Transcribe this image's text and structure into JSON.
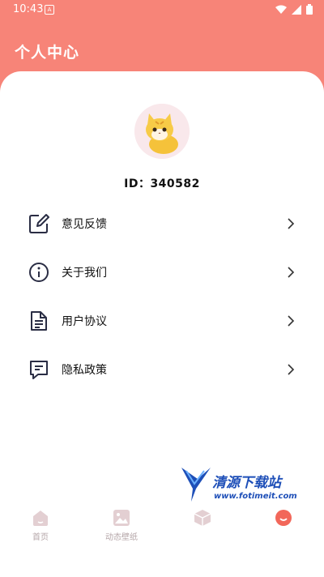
{
  "status_bar": {
    "time": "10:43",
    "notification_icon": "a-icon",
    "wifi_icon": "wifi-icon",
    "signal_icon": "signal-icon",
    "battery_icon": "battery-icon"
  },
  "header": {
    "title": "个人中心"
  },
  "profile": {
    "id_text": "ID：340582"
  },
  "menu": {
    "items": [
      {
        "label": "意见反馈",
        "icon": "edit-icon"
      },
      {
        "label": "关于我们",
        "icon": "info-icon"
      },
      {
        "label": "用户协议",
        "icon": "document-icon"
      },
      {
        "label": "隐私政策",
        "icon": "message-icon"
      }
    ]
  },
  "tabbar": {
    "tabs": [
      {
        "label": "首页",
        "icon": "home-icon"
      },
      {
        "label": "动态壁纸",
        "icon": "image-icon"
      },
      {
        "label": "",
        "icon": "box-icon"
      },
      {
        "label": "",
        "icon": "profile-icon"
      }
    ]
  },
  "watermark": {
    "title": "清源下载站",
    "url": "www.fotimeit.com"
  },
  "colors": {
    "accent": "#f78478",
    "tab_inactive": "#e3cfd2",
    "tab_active": "#f2675a"
  }
}
